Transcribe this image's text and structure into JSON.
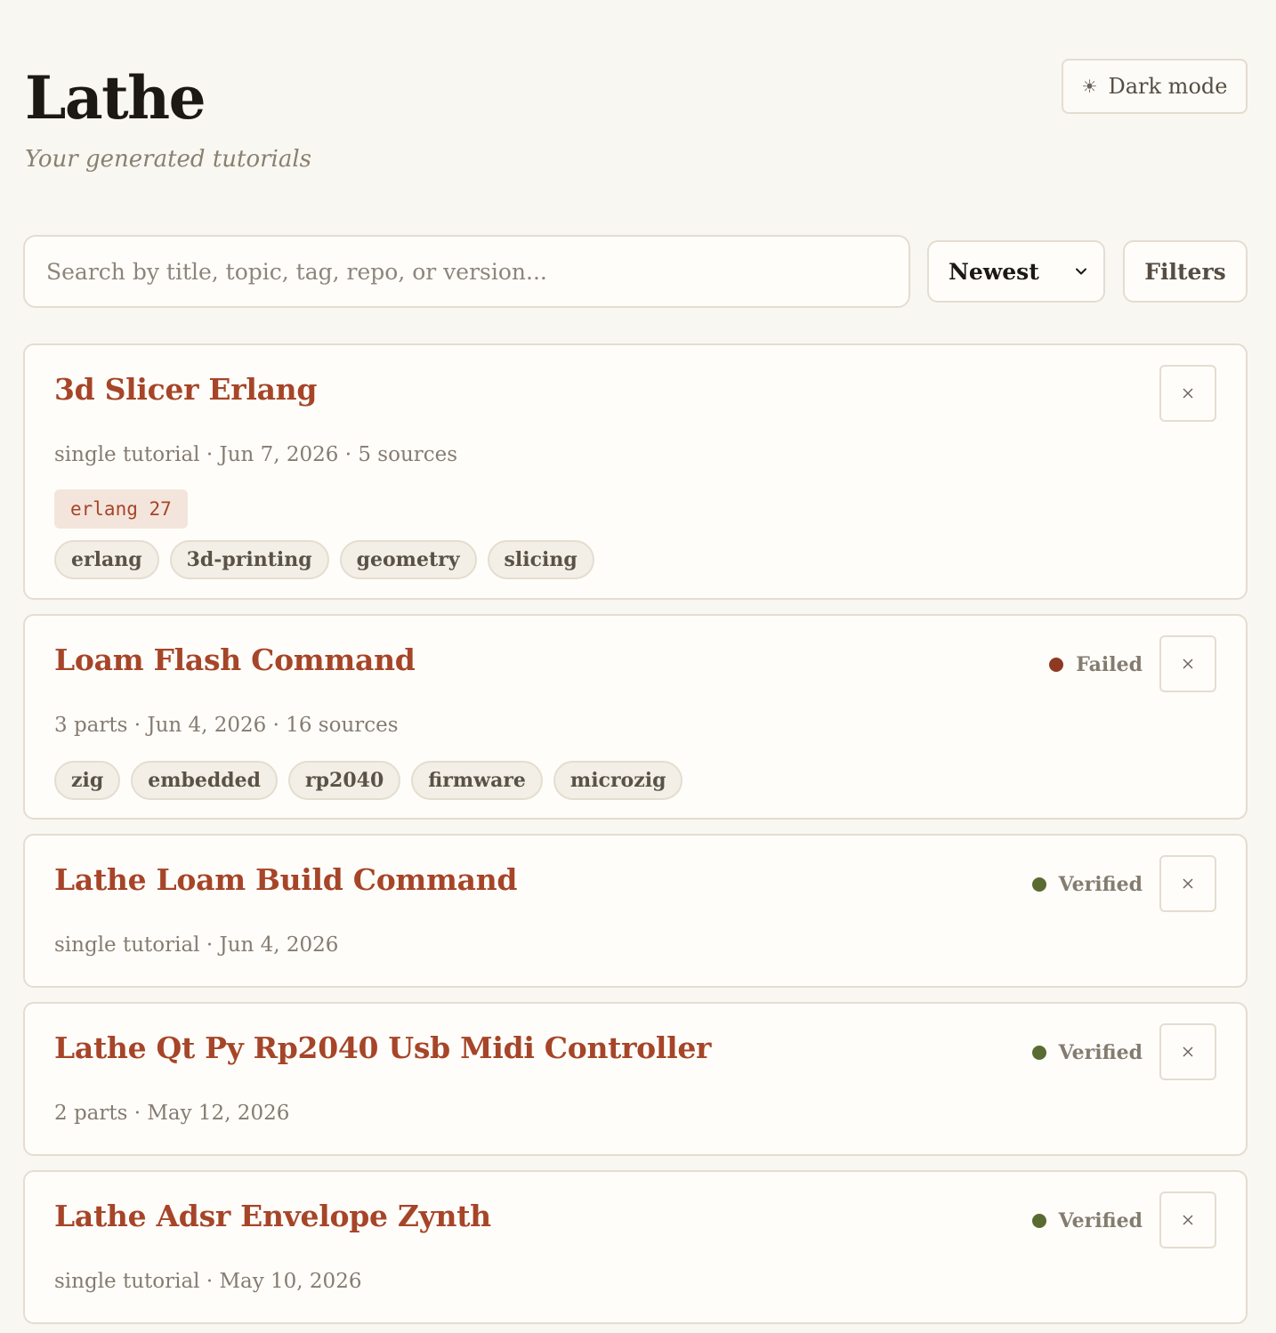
{
  "header": {
    "title": "Lathe",
    "subtitle": "Your generated tutorials",
    "dark_mode_label": "Dark mode",
    "dark_mode_icon": "sun-icon"
  },
  "toolbar": {
    "search_placeholder": "Search by title, topic, tag, repo, or version...",
    "search_value": "",
    "sort_value": "Newest",
    "filters_label": "Filters"
  },
  "colors": {
    "accent": "#a64528",
    "status_failed": "#8e3a22",
    "status_verified": "#5a6b32"
  },
  "tutorials": [
    {
      "title": "3d Slicer Erlang",
      "meta": "single tutorial · Jun 7, 2026 · 5 sources",
      "status": "",
      "version": "erlang 27",
      "tags": [
        "erlang",
        "3d-printing",
        "geometry",
        "slicing"
      ]
    },
    {
      "title": "Loam Flash Command",
      "meta": "3 parts · Jun 4, 2026 · 16 sources",
      "status": "Failed",
      "version": "",
      "tags": [
        "zig",
        "embedded",
        "rp2040",
        "firmware",
        "microzig"
      ]
    },
    {
      "title": "Lathe Loam Build Command",
      "meta": "single tutorial · Jun 4, 2026",
      "status": "Verified",
      "version": "",
      "tags": []
    },
    {
      "title": "Lathe Qt Py Rp2040 Usb Midi Controller",
      "meta": "2 parts · May 12, 2026",
      "status": "Verified",
      "version": "",
      "tags": []
    },
    {
      "title": "Lathe Adsr Envelope Zynth",
      "meta": "single tutorial · May 10, 2026",
      "status": "Verified",
      "version": "",
      "tags": []
    }
  ]
}
